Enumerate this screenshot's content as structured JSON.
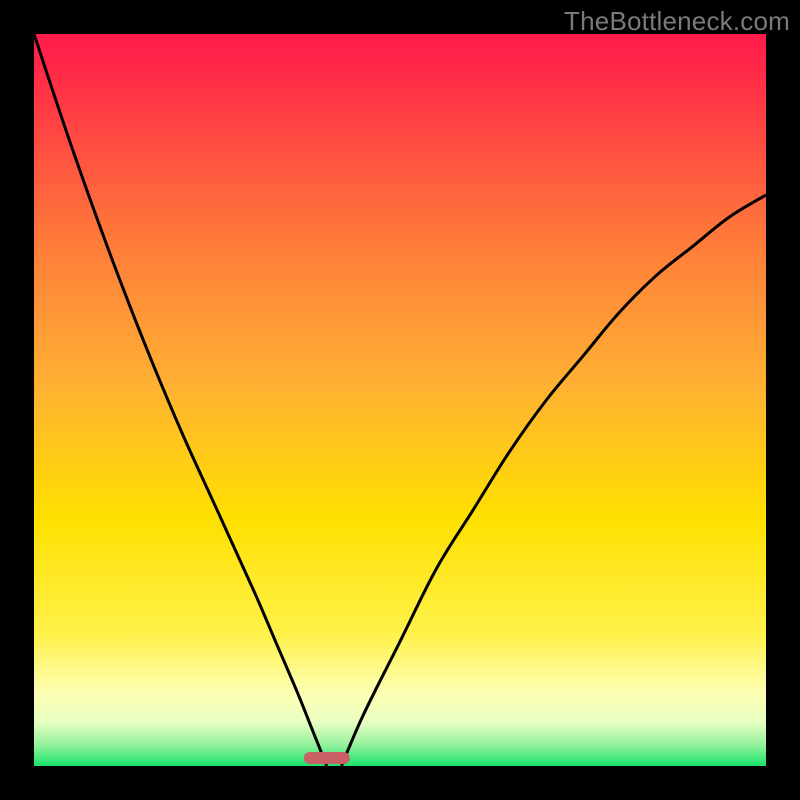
{
  "watermark": "TheBottleneck.com",
  "chart_data": {
    "type": "line",
    "title": "",
    "xlabel": "",
    "ylabel": "",
    "xlim": [
      0,
      100
    ],
    "ylim": [
      0,
      100
    ],
    "grid": false,
    "legend": false,
    "marker": {
      "x": 40,
      "color": "#c96065"
    },
    "colors": {
      "gradient_top": "#ff1a4b",
      "gradient_mid": "#ffd600",
      "gradient_low": "#fff9b0",
      "gradient_bottom": "#19e36b",
      "curve": "#000000",
      "frame": "#000000"
    },
    "series": [
      {
        "name": "left-curve",
        "x": [
          0,
          5,
          10,
          15,
          20,
          25,
          30,
          33,
          36,
          38,
          40
        ],
        "values": [
          100,
          85,
          71,
          58,
          46,
          35,
          24,
          17,
          10,
          5,
          0
        ]
      },
      {
        "name": "right-curve",
        "x": [
          42,
          45,
          50,
          55,
          60,
          65,
          70,
          75,
          80,
          85,
          90,
          95,
          100
        ],
        "values": [
          0,
          7,
          17,
          27,
          35,
          43,
          50,
          56,
          62,
          67,
          71,
          75,
          78
        ]
      }
    ]
  }
}
